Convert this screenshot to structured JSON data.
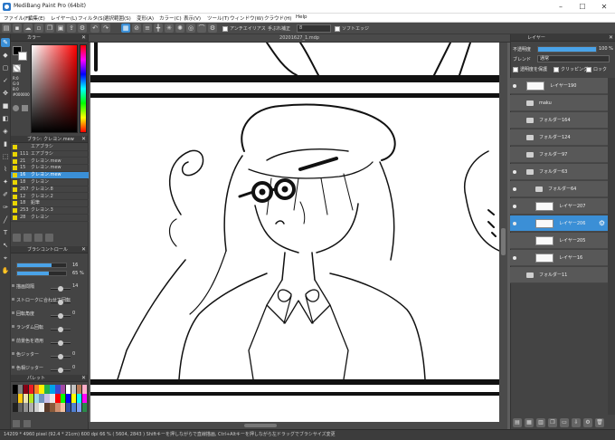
{
  "app": {
    "title": "MediBang Paint Pro (64bit)"
  },
  "window_controls": {
    "minimize": "–",
    "maximize": "☐",
    "close": "✕"
  },
  "menu": [
    "ファイル(F)",
    "編集(E)",
    "レイヤー(L)",
    "フィルタ(S)",
    "選択範囲(S)",
    "変形(A)",
    "カラー(C)",
    "表示(V)",
    "ツール(T)",
    "ウィンドウ(W)",
    "クラウド(H)",
    "Help"
  ],
  "toolbar": {
    "antialias": "アンチエイリアス",
    "stabilizer_label": "手ぶれ補正",
    "stabilizer_value": "8",
    "soft_edge": "ソフトエッジ"
  },
  "document": {
    "tab": "20201627_1.mdp"
  },
  "color_panel": {
    "title": "カラー",
    "hex_label": "#000000",
    "r": "R:0",
    "g": "G:0",
    "b": "B:0"
  },
  "brush_panel": {
    "title": "ブラシ: クレヨン.mew",
    "items": [
      {
        "size": "",
        "name": "エアブラシ"
      },
      {
        "size": "111",
        "name": "エアブラシ"
      },
      {
        "size": "21",
        "name": "クレヨン.mew"
      },
      {
        "size": "15",
        "name": "クレヨン.mew"
      },
      {
        "size": "16",
        "name": "クレヨン.mew",
        "selected": true
      },
      {
        "size": "18",
        "name": "クレヨン"
      },
      {
        "size": "267",
        "name": "クレヨン.8"
      },
      {
        "size": "12",
        "name": "クレヨン.2"
      },
      {
        "size": "18",
        "name": "鉛筆"
      },
      {
        "size": "253",
        "name": "クレヨン.3"
      },
      {
        "size": "28",
        "name": "クレヨン"
      }
    ]
  },
  "brush_control": {
    "title": "ブラシコントロール",
    "size_value": "16",
    "opacity_value": "65 %",
    "size_fill": 0.7,
    "opacity_fill": 0.65,
    "props": [
      "描画間隔",
      "ストロークに合わせて回転",
      "回転角度",
      "ランダム回転",
      "前景色を適用",
      "色ジッター",
      "色相ジッター"
    ],
    "values": [
      "14",
      "",
      "0",
      "",
      "",
      "0",
      "0"
    ]
  },
  "palette": {
    "title": "パレット",
    "colors": [
      "#000000",
      "#7f7f7f",
      "#880015",
      "#ed1c24",
      "#ff7f27",
      "#fff200",
      "#22b14c",
      "#00a2e8",
      "#3f48cc",
      "#a349a4",
      "#ffffff",
      "#c3c3c3",
      "#b97a57",
      "#ffaec9",
      "#404040",
      "#ffc90e",
      "#efe4b0",
      "#b5e61d",
      "#99d9ea",
      "#7092be",
      "#c8bfe7",
      "#e8e8e8",
      "#ff0000",
      "#00ff00",
      "#0000ff",
      "#ffff00",
      "#00ffff",
      "#ff00ff",
      "#202020",
      "#606060",
      "#909090",
      "#b0b0b0",
      "#d0d0d0",
      "#f0f0f0",
      "#5a3a2a",
      "#8a5a3a",
      "#d09070",
      "#f0c0a0",
      "#3050a0",
      "#5080d0",
      "#80a0f0",
      "#2a8a4a"
    ]
  },
  "layers_panel": {
    "title": "レイヤー",
    "opacity_label": "不透明度",
    "opacity_value": "100 %",
    "opacity_fill": 1.0,
    "blend_label": "ブレンド",
    "blend_value": "通常",
    "protect_alpha": "透明度を保護",
    "clipping": "クリッピング",
    "lock": "ロック",
    "rows": [
      {
        "name": "レイヤー190",
        "kind": "layer",
        "indent": 0,
        "eye": true
      },
      {
        "name": "maku",
        "kind": "folder",
        "indent": 0,
        "eye": false
      },
      {
        "name": "フォルダー164",
        "kind": "folder",
        "indent": 0,
        "eye": false
      },
      {
        "name": "フォルダー124",
        "kind": "folder",
        "indent": 0,
        "eye": false
      },
      {
        "name": "フォルダー97",
        "kind": "folder",
        "indent": 0,
        "eye": false
      },
      {
        "name": "フォルダー63",
        "kind": "folder",
        "indent": 0,
        "eye": true
      },
      {
        "name": "フォルダー64",
        "kind": "folder",
        "indent": 1,
        "eye": true
      },
      {
        "name": "レイヤー207",
        "kind": "layer",
        "indent": 1,
        "eye": true
      },
      {
        "name": "レイヤー206",
        "kind": "layer",
        "indent": 1,
        "eye": true,
        "selected": true
      },
      {
        "name": "レイヤー205",
        "kind": "layer",
        "indent": 1,
        "eye": false
      },
      {
        "name": "レイヤー16",
        "kind": "layer",
        "indent": 1,
        "eye": true
      },
      {
        "name": "フォルダー11",
        "kind": "folder",
        "indent": 0,
        "eye": false
      }
    ]
  },
  "status": {
    "text": "14209 * 4960 pixel  (92.4 * 21cm)   600 dpi   66 %   ( 5604, 2843 )   Shiftキーを押しながらで直線描画, Ctrl+Altキーを押しながら左ドラッグでブラシサイズ変更"
  }
}
